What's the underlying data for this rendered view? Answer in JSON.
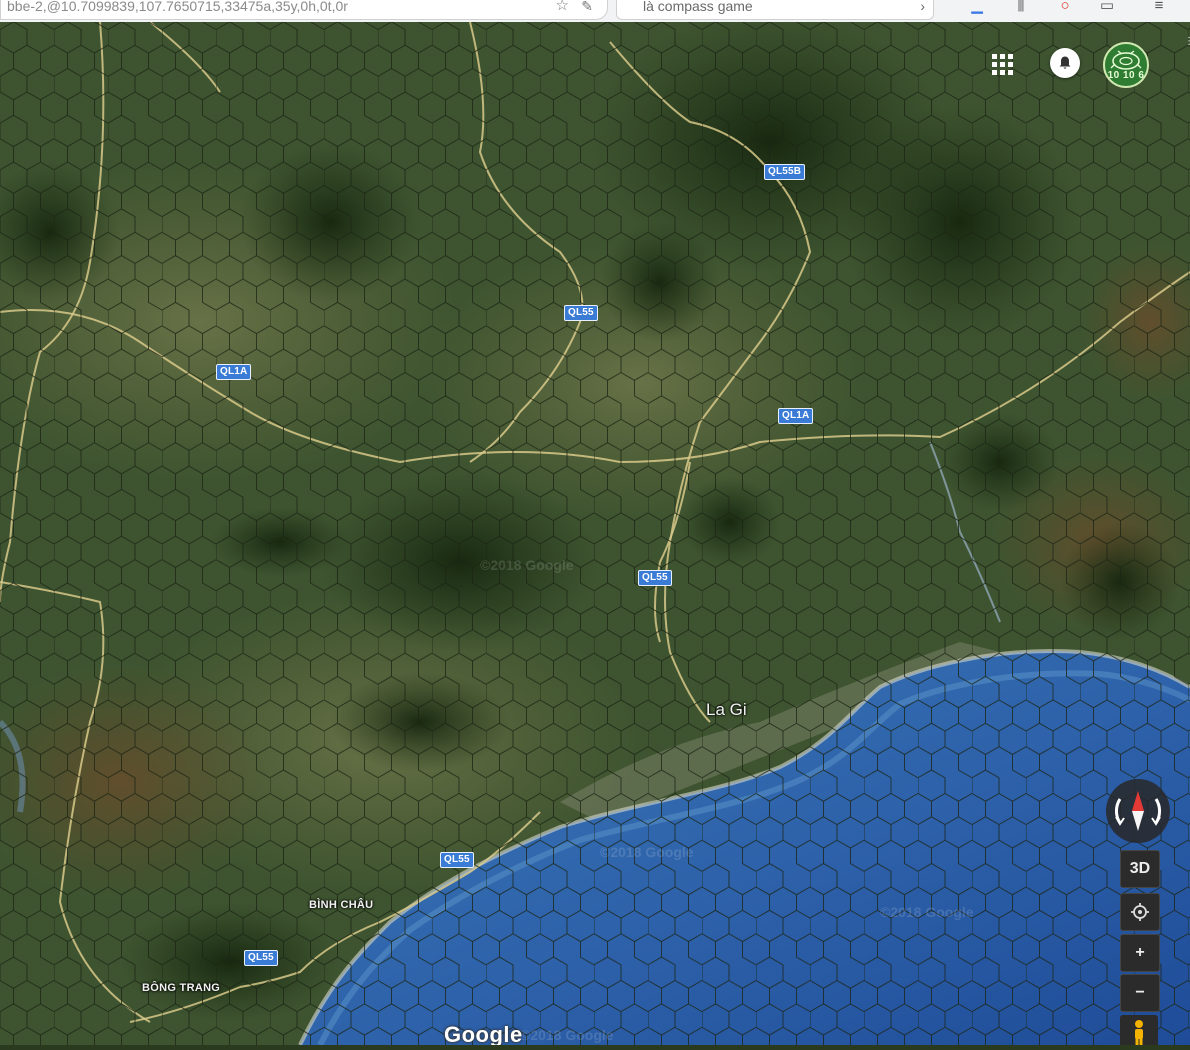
{
  "browser": {
    "address_text": "bbe-2,@10.7099839,107.7650715,33475a,35y,0h,0t,0r",
    "search_text": "là compass game"
  },
  "map": {
    "hex_grid": "on",
    "roads": [
      "QL55B",
      "QL55",
      "QL1A",
      "QL1A",
      "QL55",
      "QL55",
      "QL55"
    ],
    "places": {
      "la_gi": "La Gi",
      "binh_chau": "BÌNH CHÂU",
      "bong_trang": "BÔNG TRANG"
    },
    "watermarks": [
      "©2018 Google",
      "©2018 Google",
      "©2018 Google",
      "©2018 Google"
    ],
    "logo": "Google"
  },
  "controls": {
    "avatar_text": "10 10 6",
    "tilt_label": "3D",
    "zoom_in": "+",
    "zoom_out": "−"
  },
  "icons": {
    "apps": "apps-grid-icon",
    "notifications": "bell-icon",
    "compass": "compass-icon",
    "location": "my-location-icon",
    "pegman": "pegman-icon"
  },
  "colors": {
    "sea": "#2c5fa8",
    "land": "#3e5430",
    "road_badge": "#3a7bd5",
    "hex_line": "#1b2414"
  }
}
